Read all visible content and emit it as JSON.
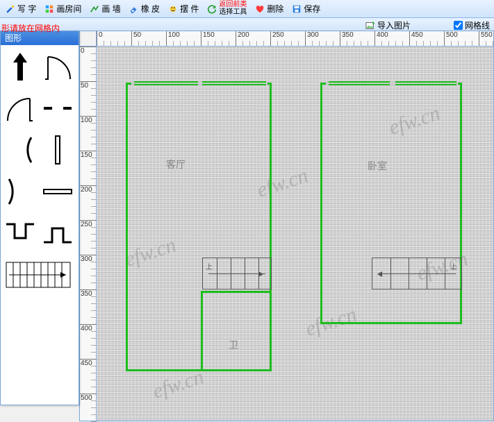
{
  "toolbar": {
    "write": "写 字",
    "draw_room": "画房间",
    "draw_wall": "画 墙",
    "eraser": "橡 皮",
    "place": "摆 件",
    "back_tool_line1": "返回前类",
    "back_tool_line2": "选择工具",
    "partial_left": "删除",
    "partial_right": "保存"
  },
  "subtoolbar": {
    "import_image": "导入图片",
    "gridlines": "网格线"
  },
  "notice": "形请放在网格内",
  "palette": {
    "title": "图形"
  },
  "ruler": {
    "h_ticks": [
      "0",
      "50",
      "100",
      "150",
      "200",
      "250",
      "300",
      "350",
      "400",
      "450",
      "500",
      "550"
    ],
    "v_ticks": [
      "0",
      "50",
      "100",
      "150",
      "200",
      "250",
      "300",
      "350",
      "400",
      "450",
      "500"
    ]
  },
  "floorplan": {
    "room1_label": "客厅",
    "room2_label": "卧室",
    "wc_label": "卫",
    "stairs_up": "上"
  },
  "watermark": "efw.cn"
}
